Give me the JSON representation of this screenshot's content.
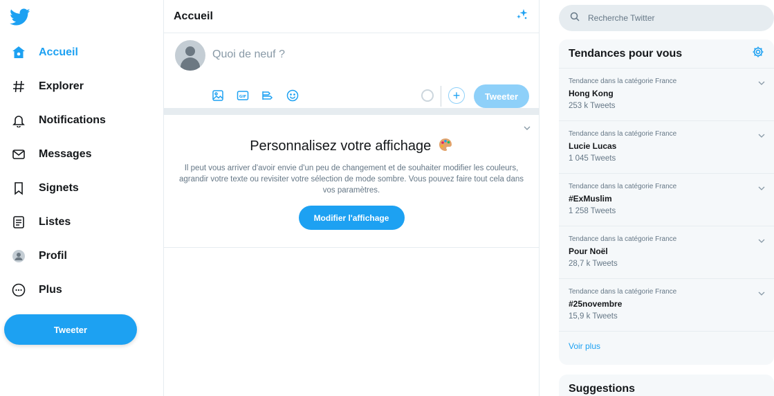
{
  "colors": {
    "accent": "#1da1f2",
    "accent_light": "#8ed0f9",
    "border": "#e6ecf0",
    "muted": "#657786"
  },
  "nav": {
    "logo_icon": "twitter-bird-icon",
    "items": [
      {
        "label": "Accueil",
        "icon": "home-icon",
        "active": true
      },
      {
        "label": "Explorer",
        "icon": "hashtag-icon"
      },
      {
        "label": "Notifications",
        "icon": "bell-icon"
      },
      {
        "label": "Messages",
        "icon": "envelope-icon"
      },
      {
        "label": "Signets",
        "icon": "bookmark-icon"
      },
      {
        "label": "Listes",
        "icon": "list-icon"
      },
      {
        "label": "Profil",
        "icon": "profile-icon"
      },
      {
        "label": "Plus",
        "icon": "more-icon"
      }
    ],
    "tweet_label": "Tweeter"
  },
  "main": {
    "title": "Accueil",
    "composer": {
      "placeholder": "Quoi de neuf ?",
      "tools": [
        "image-icon",
        "gif-icon",
        "poll-icon",
        "emoji-icon"
      ],
      "tweet_label": "Tweeter"
    },
    "card": {
      "title": "Personnalisez votre affichage",
      "text": "Il peut vous arriver d'avoir envie d'un peu de changement et de souhaiter modifier les couleurs, agrandir votre texte ou revisiter votre sélection de mode sombre. Vous pouvez faire tout cela dans vos paramètres.",
      "button_label": "Modifier l'affichage"
    }
  },
  "right": {
    "search_placeholder": "Recherche Twitter",
    "trends": {
      "title": "Tendances pour vous",
      "items": [
        {
          "category": "Tendance dans la catégorie France",
          "name": "Hong Kong",
          "count": "253 k Tweets"
        },
        {
          "category": "Tendance dans la catégorie France",
          "name": "Lucie Lucas",
          "count": "1 045 Tweets"
        },
        {
          "category": "Tendance dans la catégorie France",
          "name": "#ExMuslim",
          "count": "1 258 Tweets"
        },
        {
          "category": "Tendance dans la catégorie France",
          "name": "Pour Noël",
          "count": "28,7 k Tweets"
        },
        {
          "category": "Tendance dans la catégorie France",
          "name": "#25novembre",
          "count": "15,9 k Tweets"
        }
      ],
      "more_label": "Voir plus"
    },
    "suggestions_title": "Suggestions"
  }
}
